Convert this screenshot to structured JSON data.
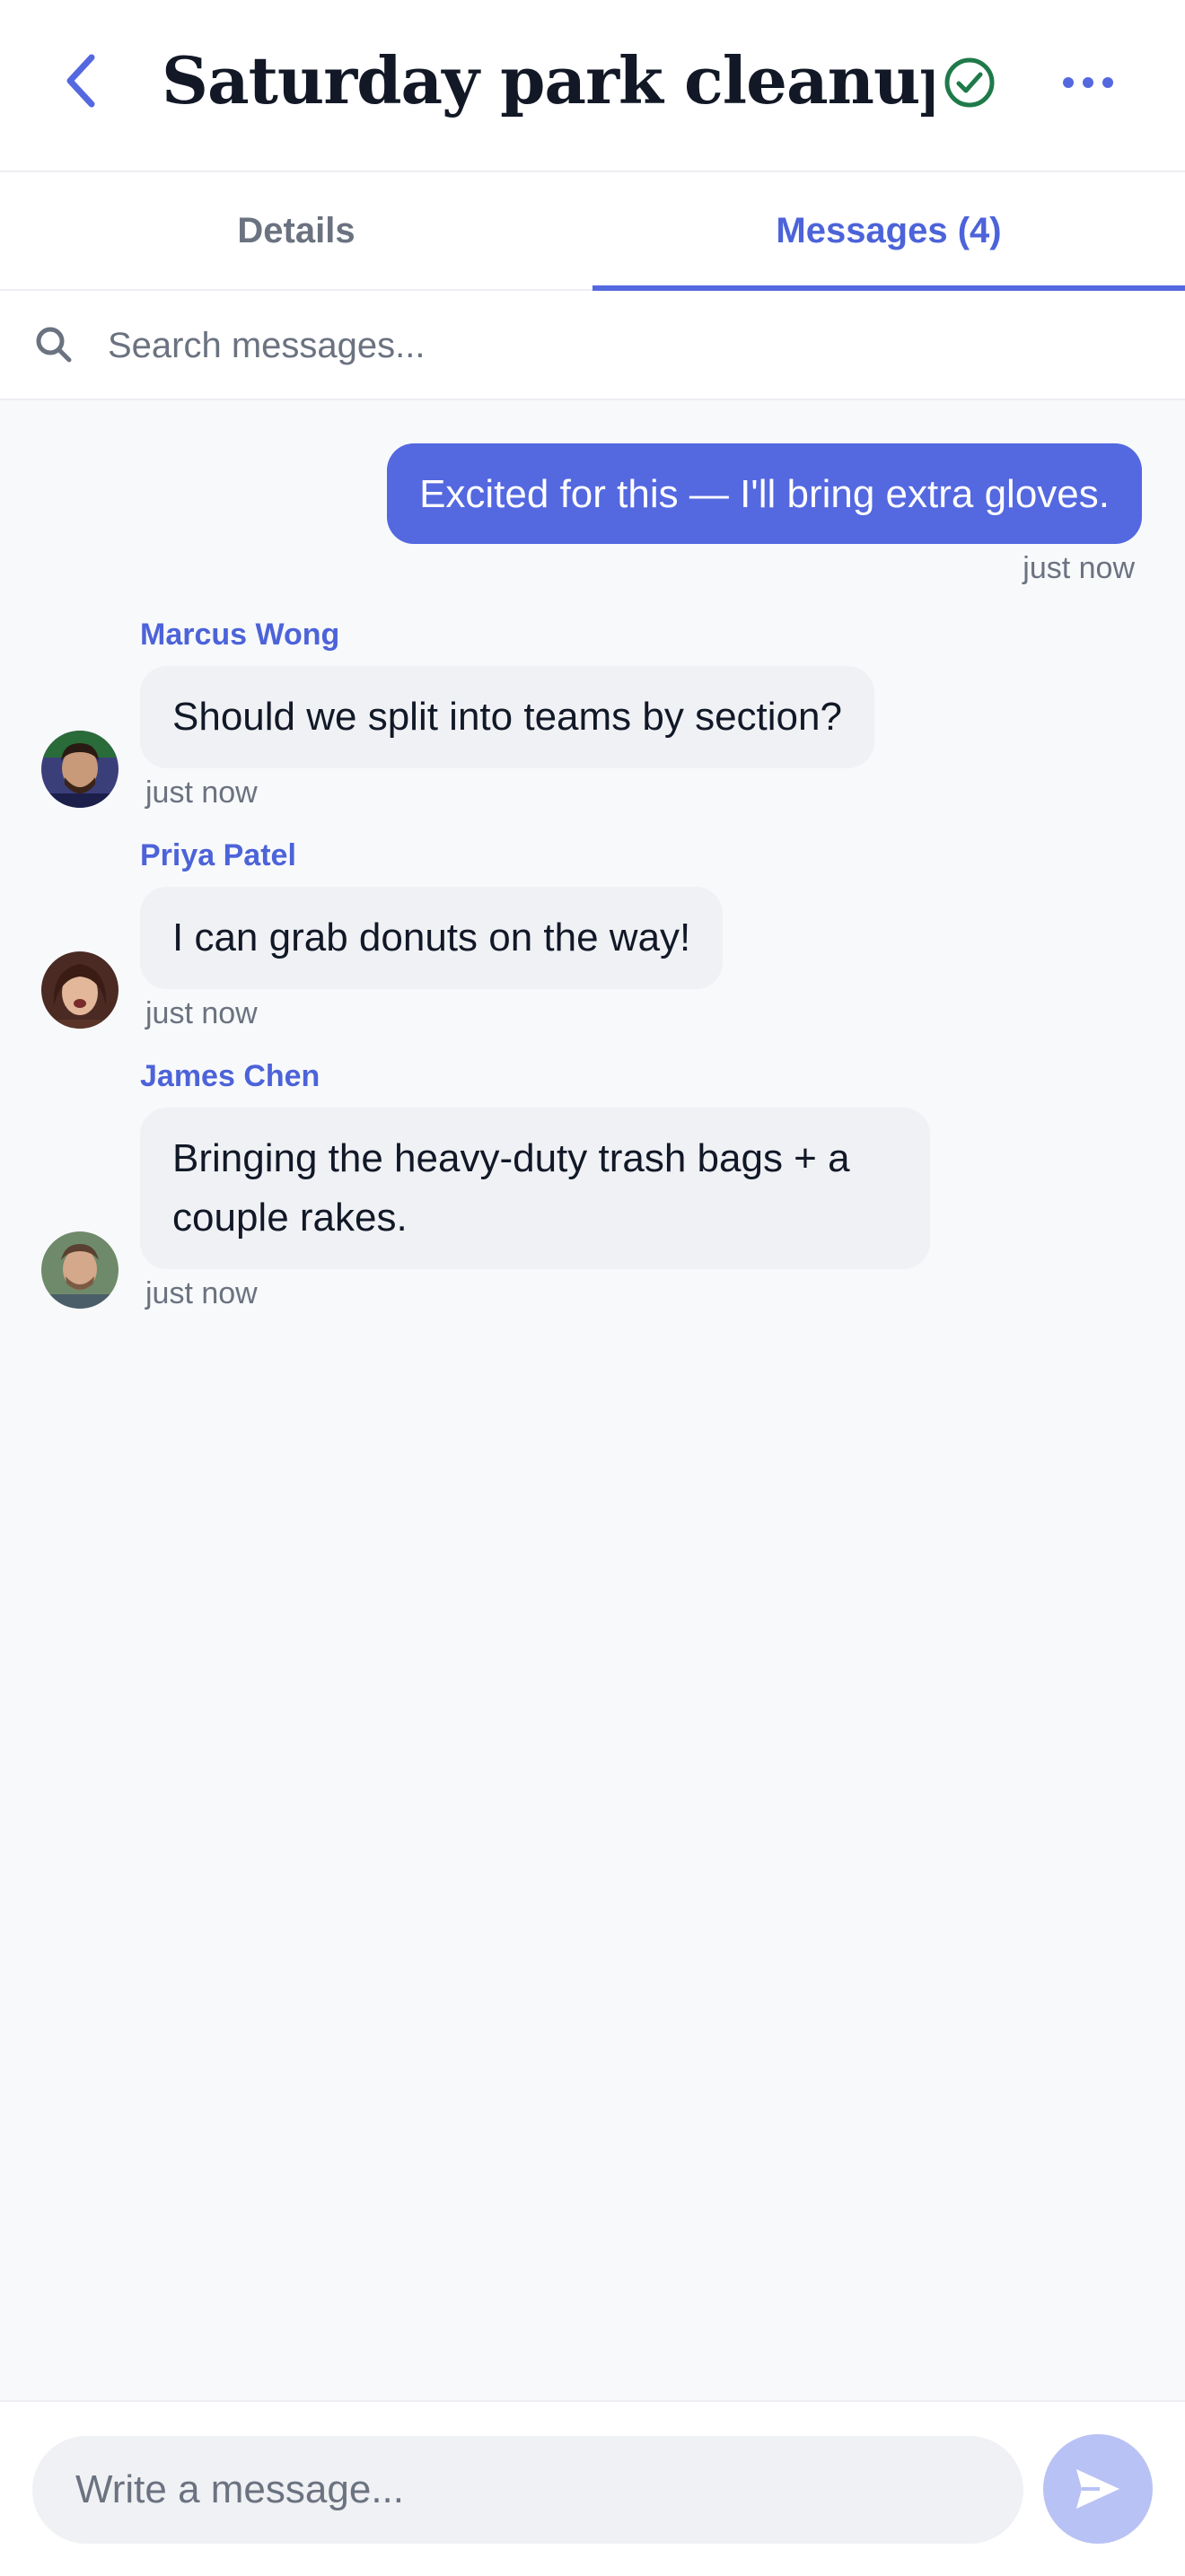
{
  "header": {
    "title": "Saturday park cleanup",
    "back_icon": "chevron-left-icon",
    "status_icon": "check-circle-icon",
    "more_icon": "ellipsis-icon"
  },
  "tabs": [
    {
      "label": "Details",
      "active": false
    },
    {
      "label": "Messages (4)",
      "active": true
    }
  ],
  "search": {
    "placeholder": "Search messages...",
    "value": ""
  },
  "messages": [
    {
      "sender": "",
      "text": "Excited for this — I'll bring extra gloves.",
      "time": "just now",
      "outgoing": true
    },
    {
      "sender": "Marcus Wong",
      "text": "Should we split into teams by section?",
      "time": "just now",
      "outgoing": false
    },
    {
      "sender": "Priya Patel",
      "text": "I can grab donuts on the way!",
      "time": "just now",
      "outgoing": false
    },
    {
      "sender": "James Chen",
      "text": "Bringing the heavy-duty trash bags + a couple rakes.",
      "time": "just now",
      "outgoing": false
    }
  ],
  "composer": {
    "placeholder": "Write a message...",
    "value": "",
    "send_icon": "send-icon"
  },
  "colors": {
    "accent": "#5468e0",
    "accent_text": "#4c63d9",
    "success": "#1f7a4a",
    "bubble_incoming": "#f0f1f4",
    "background": "#f8f9fb"
  }
}
